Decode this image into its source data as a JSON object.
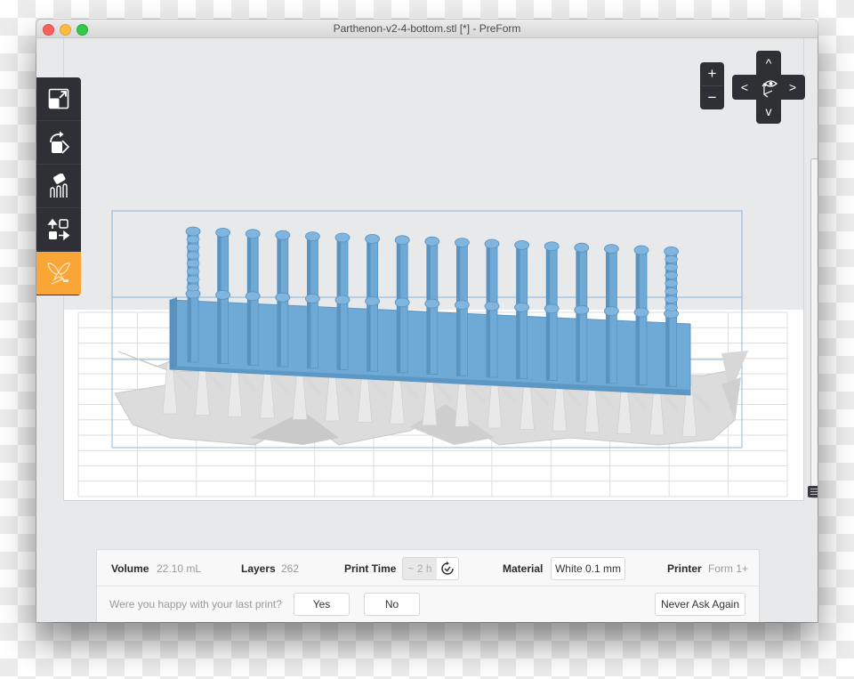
{
  "window": {
    "title": "Parthenon-v2-4-bottom.stl [*] - PreForm"
  },
  "sidebar": {
    "items": [
      {
        "name": "scale",
        "icon": "scale-icon",
        "active": false
      },
      {
        "name": "orient",
        "icon": "rotate-icon",
        "active": false
      },
      {
        "name": "supports",
        "icon": "supports-icon",
        "active": false
      },
      {
        "name": "layout",
        "icon": "layout-icon",
        "active": false
      },
      {
        "name": "print",
        "icon": "butterfly-print-icon",
        "active": true
      }
    ],
    "active_color": "#f9a636"
  },
  "view_controls": {
    "zoom_in": "+",
    "zoom_out": "−",
    "pan_up": "^",
    "pan_down": "v",
    "pan_left": "<",
    "pan_right": ">",
    "center_icon": "view-eye-axes-icon"
  },
  "model": {
    "columns_visible": 17,
    "model_color": "#6faad7",
    "support_color": "#dcdcdc",
    "bounding_box_color": "#8ab8dc"
  },
  "info": {
    "volume_label": "Volume",
    "volume_value": "22.10 mL",
    "layers_label": "Layers",
    "layers_value": "262",
    "print_time_label": "Print Time",
    "print_time_value": "~ 2 h",
    "material_label": "Material",
    "material_value": "White 0.1 mm",
    "printer_label": "Printer",
    "printer_value": "Form 1+"
  },
  "feedback": {
    "question": "Were you happy with your last print?",
    "yes": "Yes",
    "no": "No",
    "never": "Never Ask Again"
  }
}
